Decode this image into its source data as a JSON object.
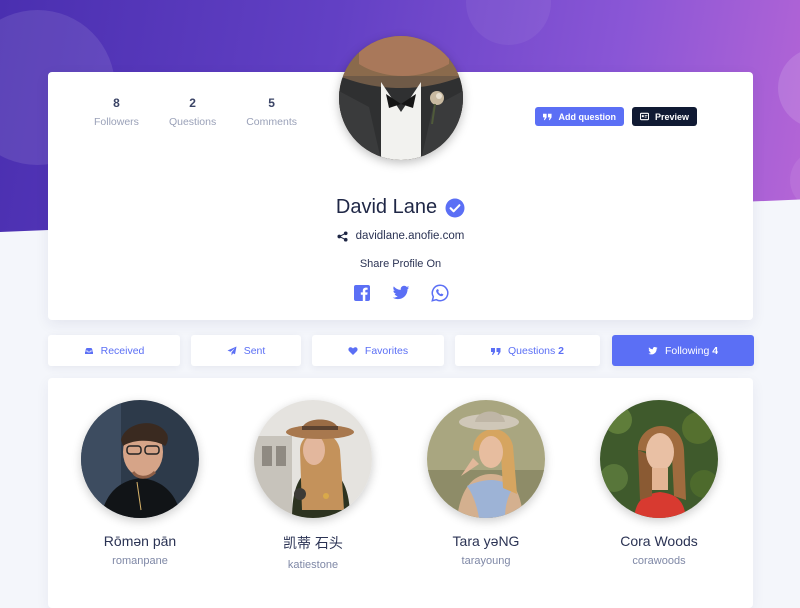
{
  "stats": [
    {
      "value": "8",
      "label": "Followers"
    },
    {
      "value": "2",
      "label": "Questions"
    },
    {
      "value": "5",
      "label": "Comments"
    }
  ],
  "actions": {
    "add_question": "Add question",
    "preview": "Preview"
  },
  "profile": {
    "name": "David Lane",
    "verified": true,
    "url": "davidlane.anofie.com",
    "share_label": "Share Profile On",
    "share_targets": [
      "facebook-icon",
      "twitter-icon",
      "whatsapp-icon"
    ]
  },
  "tabs": [
    {
      "label": "Received",
      "icon": "inbox-icon",
      "count": "",
      "active": false
    },
    {
      "label": "Sent",
      "icon": "paper-plane-icon",
      "count": "",
      "active": false
    },
    {
      "label": "Favorites",
      "icon": "heart-icon",
      "count": "",
      "active": false
    },
    {
      "label": "Questions",
      "icon": "quote-icon",
      "count": "2",
      "active": false
    },
    {
      "label": "Following",
      "icon": "twitter-icon",
      "count": "4",
      "active": true
    }
  ],
  "following": [
    {
      "name": "Rōmən pān",
      "username": "romanpane"
    },
    {
      "name": "凯蒂 石头",
      "username": "katiestone"
    },
    {
      "name": "Tara yəNG",
      "username": "tarayoung"
    },
    {
      "name": "Cora Woods",
      "username": "corawoods"
    }
  ],
  "colors": {
    "accent": "#5b6ff5",
    "dark_button": "#101a33",
    "hero_start": "#4a2fb0",
    "hero_end": "#b565d6"
  }
}
